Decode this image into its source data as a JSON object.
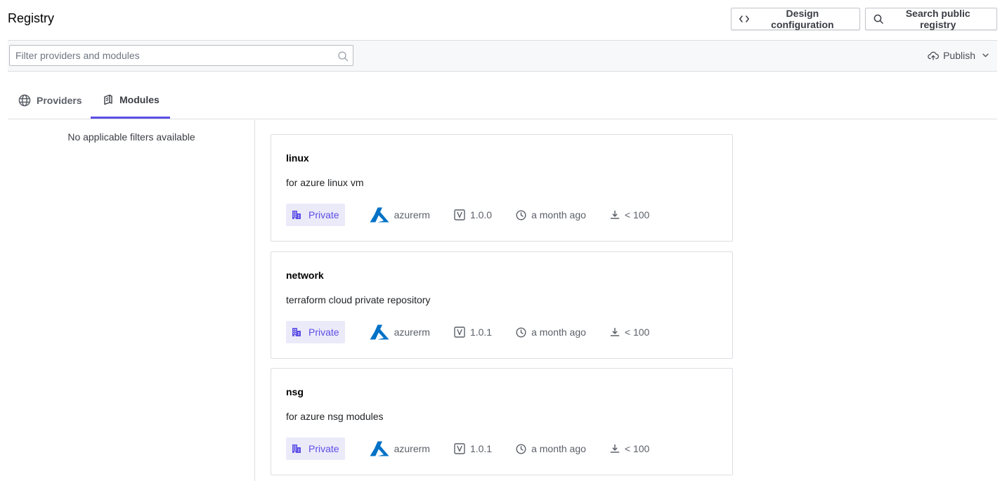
{
  "header": {
    "title": "Registry",
    "design_config_label": "Design configuration",
    "search_public_label": "Search public registry"
  },
  "filter": {
    "placeholder": "Filter providers and modules",
    "value": "",
    "publish_label": "Publish"
  },
  "tabs": [
    {
      "label": "Providers",
      "icon": "globe-icon",
      "active": false
    },
    {
      "label": "Modules",
      "icon": "module-icon",
      "active": true
    }
  ],
  "sidebar": {
    "empty_message": "No applicable filters available"
  },
  "modules": [
    {
      "name": "linux",
      "description": "for azure linux vm",
      "visibility": "Private",
      "provider": "azurerm",
      "version": "1.0.0",
      "published": "a month ago",
      "downloads": "< 100"
    },
    {
      "name": "network",
      "description": "terraform cloud private repository",
      "visibility": "Private",
      "provider": "azurerm",
      "version": "1.0.1",
      "published": "a month ago",
      "downloads": "< 100"
    },
    {
      "name": "nsg",
      "description": "for azure nsg modules",
      "visibility": "Private",
      "provider": "azurerm",
      "version": "1.0.1",
      "published": "a month ago",
      "downloads": "< 100"
    }
  ],
  "colors": {
    "accent": "#5c4ee5",
    "badge_bg": "#ebeaf9",
    "azure_blue": "#0072c6"
  }
}
